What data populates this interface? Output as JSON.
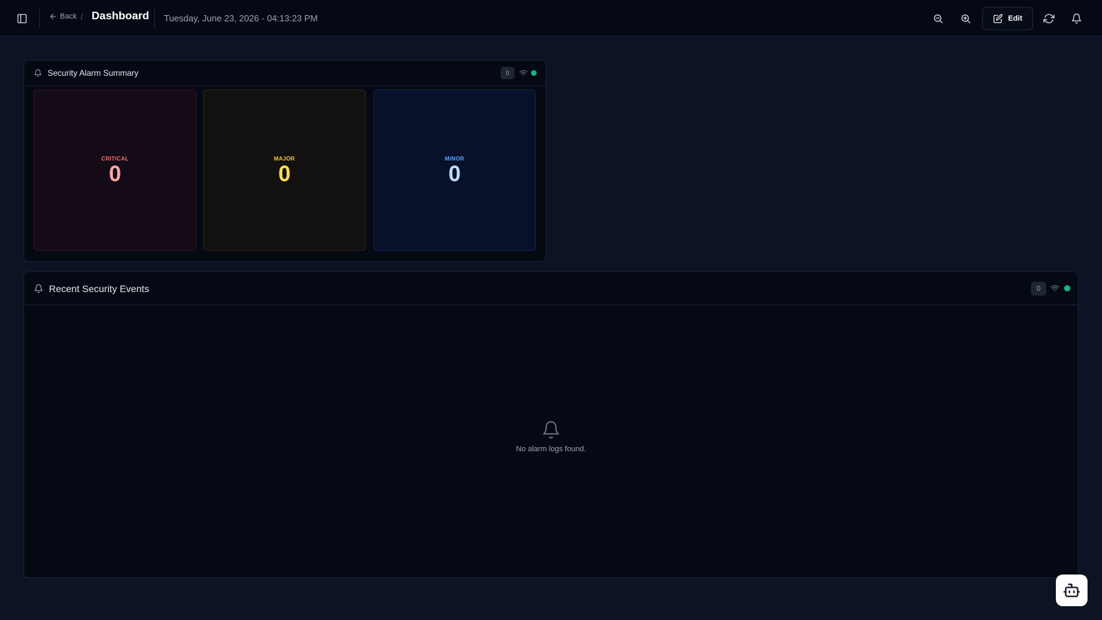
{
  "header": {
    "back_label": "Back",
    "separator": "/",
    "title": "Dashboard",
    "datetime": "Tuesday, June 23, 2026 - 04:13:23 PM",
    "edit_label": "Edit",
    "icons": [
      "panel-left-icon",
      "arrow-left-icon",
      "zoom-out-icon",
      "zoom-in-icon",
      "edit-icon",
      "refresh-icon",
      "bell-icon"
    ]
  },
  "alarm_summary": {
    "title": "Security Alarm Summary",
    "badge_count": "0",
    "status_color": "#10b981",
    "cards": [
      {
        "label": "CRITICAL",
        "count": "0",
        "accent": "#f87171"
      },
      {
        "label": "MAJOR",
        "count": "0",
        "accent": "#facc15"
      },
      {
        "label": "MINOR",
        "count": "0",
        "accent": "#60a5fa"
      }
    ]
  },
  "recent_events": {
    "title": "Recent Security Events",
    "badge_count": "0",
    "status_color": "#10b981",
    "empty_message": "No alarm logs found."
  },
  "assistant": {
    "icon": "bot-icon"
  }
}
